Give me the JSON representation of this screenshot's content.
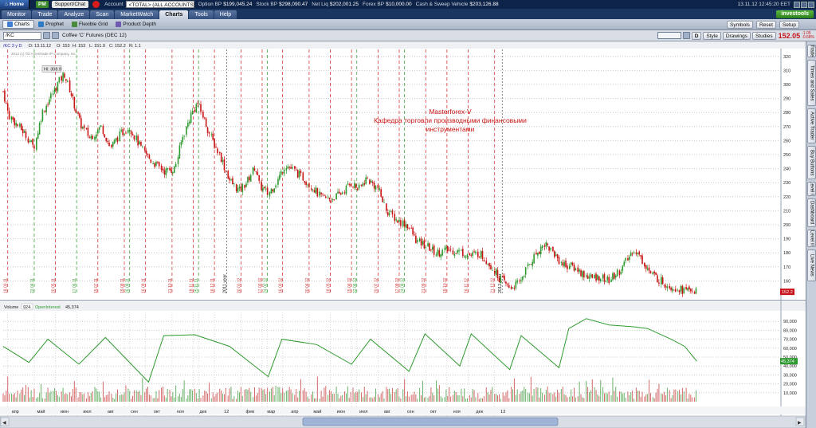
{
  "topbar": {
    "home": "Home",
    "pm": "PM",
    "support": "Support/Chat",
    "account_label": "Account",
    "account_value": "<TOTAL> (ALL ACCOUNTS)",
    "metrics": [
      {
        "label": "Option BP",
        "value": "$199,045.24"
      },
      {
        "label": "Stock BP",
        "value": "$298,090.47"
      },
      {
        "label": "Net Liq",
        "value": "$202,001.25"
      },
      {
        "label": "Forex BP",
        "value": "$10,000.00"
      },
      {
        "label": "Cash & Sweep Vehicle",
        "value": "$203,126.88"
      }
    ],
    "clock": "13.11.12 12:45:20 EET"
  },
  "tabs": [
    "Monitor",
    "Trade",
    "Analyze",
    "Scan",
    "MarketWatch",
    "Charts",
    "Tools",
    "Help"
  ],
  "active_tab": "Charts",
  "investools": "investools",
  "subtabs": [
    {
      "label": "Charts",
      "color": "#3f7fd1"
    },
    {
      "label": "Prophet",
      "color": "#2d7bc4"
    },
    {
      "label": "Flexible Grid",
      "color": "#4a8a3c"
    },
    {
      "label": "Product Depth",
      "color": "#6d5ab0"
    }
  ],
  "chart_toolbar": {
    "symbol": "/KC",
    "description": "Coffee 'C' Futures (DEC 12)",
    "d_btn": "D",
    "style": "Style",
    "drawings": "Drawings",
    "studies": "Studies",
    "symbols": "Symbols",
    "reset": "Reset",
    "setup": "Setup",
    "last": "152.05",
    "chg1": "-1.05",
    "chg2": "-0.68%"
  },
  "price_header": {
    "symbol": "/KC 3 y D",
    "date": "D: 13.11.12",
    "open": "O: 153",
    "high": "H: 153",
    "low": "L: 151.9",
    "close": "C: 152.2",
    "range": "R: 1.1"
  },
  "copyright": "2012 (c) TD Ameritrade IP Company, Inc.",
  "high_label": "Hi: 308.9",
  "annotation": {
    "line1": "Masterforex-V",
    "line2": "Кафедра торговли производными финансовыми",
    "line3": "инструментами"
  },
  "current_price_label": "152.2",
  "volume_header": {
    "label": "Volume",
    "value": "924",
    "oi_label": "OpenInterest",
    "oi_value": "45,374"
  },
  "oi_current_label": "45,374",
  "right_rail": [
    "Trade",
    "Times and Sales",
    "Active Trader",
    "Buy Buttons",
    "Level II",
    "Dashboard",
    "Level II",
    "Live News"
  ],
  "colors": {
    "up": "#2f9a2f",
    "down": "#c81414",
    "oi_line": "#2f9a2f",
    "red_vline": "#d43a3a",
    "green_vline": "#3ea33e"
  },
  "chart_data": [
    {
      "type": "candlestick",
      "title": "",
      "x_range": [
        "2010-03-12",
        "2012-12-31"
      ],
      "ylim": [
        150,
        325
      ],
      "y_ticks": [
        160,
        170,
        180,
        190,
        200,
        210,
        220,
        230,
        240,
        250,
        260,
        270,
        280,
        290,
        300,
        310,
        320
      ],
      "grid": true,
      "high": 308.9,
      "last_close": 152.2,
      "series": [
        {
          "date": "2010-03-12",
          "close": 295
        },
        {
          "date": "2010-03-20",
          "close": 278
        },
        {
          "date": "2010-04-10",
          "close": 265
        },
        {
          "date": "2010-04-22",
          "close": 255
        },
        {
          "date": "2010-05-03",
          "close": 280
        },
        {
          "date": "2010-05-15",
          "close": 292
        },
        {
          "date": "2010-05-24",
          "close": 301
        },
        {
          "date": "2010-06-01",
          "close": 308
        },
        {
          "date": "2010-06-12",
          "close": 290
        },
        {
          "date": "2010-06-22",
          "close": 272
        },
        {
          "date": "2010-07-05",
          "close": 262
        },
        {
          "date": "2010-07-20",
          "close": 270
        },
        {
          "date": "2010-08-01",
          "close": 255
        },
        {
          "date": "2010-08-15",
          "close": 265
        },
        {
          "date": "2010-08-26",
          "close": 270
        },
        {
          "date": "2010-09-10",
          "close": 255
        },
        {
          "date": "2010-09-25",
          "close": 245
        },
        {
          "date": "2010-10-12",
          "close": 238
        },
        {
          "date": "2010-10-25",
          "close": 240
        },
        {
          "date": "2010-11-03",
          "close": 260
        },
        {
          "date": "2010-11-15",
          "close": 278
        },
        {
          "date": "2010-11-24",
          "close": 287
        },
        {
          "date": "2010-12-03",
          "close": 275
        },
        {
          "date": "2010-12-12",
          "close": 262
        },
        {
          "date": "2010-12-25",
          "close": 248
        },
        {
          "date": "2011-01-05",
          "close": 232
        },
        {
          "date": "2011-01-18",
          "close": 224
        },
        {
          "date": "2011-01-30",
          "close": 232
        },
        {
          "date": "2011-02-08",
          "close": 242
        },
        {
          "date": "2011-02-14",
          "close": 228
        },
        {
          "date": "2011-02-25",
          "close": 222
        },
        {
          "date": "2011-03-08",
          "close": 230
        },
        {
          "date": "2011-03-20",
          "close": 243
        },
        {
          "date": "2011-04-02",
          "close": 238
        },
        {
          "date": "2011-04-15",
          "close": 232
        },
        {
          "date": "2011-04-28",
          "close": 225
        },
        {
          "date": "2011-05-05",
          "close": 220
        },
        {
          "date": "2011-05-18",
          "close": 218
        },
        {
          "date": "2011-06-01",
          "close": 222
        },
        {
          "date": "2011-06-15",
          "close": 230
        },
        {
          "date": "2011-06-25",
          "close": 225
        },
        {
          "date": "2011-07-05",
          "close": 233
        },
        {
          "date": "2011-07-20",
          "close": 226
        },
        {
          "date": "2011-08-01",
          "close": 210
        },
        {
          "date": "2011-08-15",
          "close": 203
        },
        {
          "date": "2011-08-28",
          "close": 200
        },
        {
          "date": "2011-09-10",
          "close": 188
        },
        {
          "date": "2011-09-25",
          "close": 184
        },
        {
          "date": "2011-10-05",
          "close": 180
        },
        {
          "date": "2011-10-20",
          "close": 182
        },
        {
          "date": "2011-11-05",
          "close": 181
        },
        {
          "date": "2011-11-20",
          "close": 178
        },
        {
          "date": "2011-12-01",
          "close": 180
        },
        {
          "date": "2011-12-15",
          "close": 172
        },
        {
          "date": "2011-12-28",
          "close": 162
        },
        {
          "date": "2012-01-10",
          "close": 155
        },
        {
          "date": "2012-01-22",
          "close": 158
        },
        {
          "date": "2012-02-03",
          "close": 170
        },
        {
          "date": "2012-02-15",
          "close": 180
        },
        {
          "date": "2012-02-26",
          "close": 187
        },
        {
          "date": "2012-03-08",
          "close": 180
        },
        {
          "date": "2012-03-20",
          "close": 172
        },
        {
          "date": "2012-04-03",
          "close": 170
        },
        {
          "date": "2012-04-16",
          "close": 165
        },
        {
          "date": "2012-04-28",
          "close": 162
        },
        {
          "date": "2012-05-08",
          "close": 163
        },
        {
          "date": "2012-05-20",
          "close": 160
        },
        {
          "date": "2012-06-05",
          "close": 168
        },
        {
          "date": "2012-06-15",
          "close": 176
        },
        {
          "date": "2012-06-22",
          "close": 183
        },
        {
          "date": "2012-07-03",
          "close": 175
        },
        {
          "date": "2012-07-15",
          "close": 165
        },
        {
          "date": "2012-07-28",
          "close": 160
        },
        {
          "date": "2012-08-10",
          "close": 156
        },
        {
          "date": "2012-08-20",
          "close": 155
        },
        {
          "date": "2012-08-28",
          "close": 153
        },
        {
          "date": "2012-09-05",
          "close": 154
        },
        {
          "date": "2012-09-13",
          "close": 152.2
        }
      ]
    },
    {
      "type": "bar+line",
      "title": "",
      "ylim": [
        0,
        100000
      ],
      "y_ticks": [
        10000,
        20000,
        30000,
        40000,
        50000,
        60000,
        70000,
        80000,
        90000
      ],
      "oi_series": [
        {
          "date": "2010-03-12",
          "value": 62000
        },
        {
          "date": "2010-04-15",
          "value": 44000
        },
        {
          "date": "2010-05-10",
          "value": 70000
        },
        {
          "date": "2010-06-20",
          "value": 42000
        },
        {
          "date": "2010-07-25",
          "value": 72000
        },
        {
          "date": "2010-09-20",
          "value": 22000
        },
        {
          "date": "2010-10-10",
          "value": 74000
        },
        {
          "date": "2010-11-20",
          "value": 75000
        },
        {
          "date": "2011-01-05",
          "value": 62000
        },
        {
          "date": "2011-02-25",
          "value": 28000
        },
        {
          "date": "2011-03-15",
          "value": 70000
        },
        {
          "date": "2011-04-30",
          "value": 64000
        },
        {
          "date": "2011-06-15",
          "value": 42000
        },
        {
          "date": "2011-07-10",
          "value": 70000
        },
        {
          "date": "2011-08-30",
          "value": 34000
        },
        {
          "date": "2011-09-20",
          "value": 76000
        },
        {
          "date": "2011-11-05",
          "value": 40000
        },
        {
          "date": "2011-11-20",
          "value": 76000
        },
        {
          "date": "2012-01-10",
          "value": 36000
        },
        {
          "date": "2012-01-25",
          "value": 74000
        },
        {
          "date": "2012-03-15",
          "value": 38000
        },
        {
          "date": "2012-03-28",
          "value": 82000
        },
        {
          "date": "2012-04-20",
          "value": 93000
        },
        {
          "date": "2012-05-20",
          "value": 86000
        },
        {
          "date": "2012-06-20",
          "value": 84000
        },
        {
          "date": "2012-07-10",
          "value": 82000
        },
        {
          "date": "2012-08-10",
          "value": 70000
        },
        {
          "date": "2012-08-28",
          "value": 62000
        },
        {
          "date": "2012-09-13",
          "value": 45374
        }
      ]
    }
  ],
  "vlines": [
    {
      "date": "2010-03-18",
      "color": "red",
      "label": "18.03.11"
    },
    {
      "date": "2010-04-22",
      "color": "green",
      "label": "22.04.11"
    },
    {
      "date": "2010-05-20",
      "color": "red",
      "label": "20.05.11"
    },
    {
      "date": "2010-06-17",
      "color": "green",
      "label": "17.06.11"
    },
    {
      "date": "2010-07-15",
      "color": "red",
      "label": "15.07.11"
    },
    {
      "date": "2010-08-19",
      "color": "red",
      "label": "19.08.11"
    },
    {
      "date": "2010-08-26",
      "color": "green",
      "label": "26.08.11"
    },
    {
      "date": "2010-09-16",
      "color": "red",
      "label": "16.09.11"
    },
    {
      "date": "2010-10-21",
      "color": "red",
      "label": "21.10.11"
    },
    {
      "date": "2010-11-18",
      "color": "red",
      "label": "18.11.11"
    },
    {
      "date": "2010-11-25",
      "color": "green",
      "label": "25.11.11"
    },
    {
      "date": "2010-12-16",
      "color": "red",
      "label": "16.12.11"
    },
    {
      "date": "2011-01-20",
      "color": "red",
      "label": "20.01.12"
    },
    {
      "date": "2011-02-17",
      "color": "red",
      "label": "17.02.12"
    },
    {
      "date": "2011-02-24",
      "color": "green",
      "label": "24.02.12"
    },
    {
      "date": "2011-03-16",
      "color": "red",
      "label": "16.03.12"
    },
    {
      "date": "2011-04-20",
      "color": "red",
      "label": "20.04.12"
    },
    {
      "date": "2011-05-18",
      "color": "red",
      "label": "18.05.12"
    },
    {
      "date": "2011-06-15",
      "color": "red",
      "label": "15.06.12"
    },
    {
      "date": "2011-06-22",
      "color": "green",
      "label": "22.06.12"
    },
    {
      "date": "2011-07-20",
      "color": "red",
      "label": "20.07.12"
    },
    {
      "date": "2011-08-17",
      "color": "red",
      "label": "17.08.12"
    },
    {
      "date": "2011-08-24",
      "color": "green",
      "label": "24.08.12"
    },
    {
      "date": "2011-09-21",
      "color": "red",
      "label": "21.09.12"
    },
    {
      "date": "2011-10-19",
      "color": "red",
      "label": "19.10.12"
    },
    {
      "date": "2011-11-16",
      "color": "red",
      "label": "16.11.12"
    },
    {
      "date": "2011-12-21",
      "color": "red",
      "label": "21.12.12"
    }
  ],
  "year_marks": [
    {
      "date": "2011-01-01",
      "label": "2011 year"
    },
    {
      "date": "2011-12-31",
      "label": "2012 year"
    }
  ],
  "month_labels": [
    {
      "date": "2010-03-28",
      "label": "апр"
    },
    {
      "date": "2010-05-01",
      "label": "май"
    },
    {
      "date": "2010-06-01",
      "label": "июн"
    },
    {
      "date": "2010-07-01",
      "label": "июл"
    },
    {
      "date": "2010-08-01",
      "label": "авг"
    },
    {
      "date": "2010-09-01",
      "label": "сен"
    },
    {
      "date": "2010-10-01",
      "label": "окт"
    },
    {
      "date": "2010-11-01",
      "label": "ноя"
    },
    {
      "date": "2010-12-01",
      "label": "дек"
    },
    {
      "date": "2011-01-01",
      "label": "12"
    },
    {
      "date": "2011-02-01",
      "label": "фев"
    },
    {
      "date": "2011-03-01",
      "label": "мар"
    },
    {
      "date": "2011-04-01",
      "label": "апр"
    },
    {
      "date": "2011-05-01",
      "label": "май"
    },
    {
      "date": "2011-06-01",
      "label": "июн"
    },
    {
      "date": "2011-07-01",
      "label": "июл"
    },
    {
      "date": "2011-08-01",
      "label": "авг"
    },
    {
      "date": "2011-09-01",
      "label": "сен"
    },
    {
      "date": "2011-10-01",
      "label": "окт"
    },
    {
      "date": "2011-11-01",
      "label": "ноя"
    },
    {
      "date": "2011-12-01",
      "label": "дек"
    },
    {
      "date": "2012-01-01",
      "label": "13"
    }
  ]
}
